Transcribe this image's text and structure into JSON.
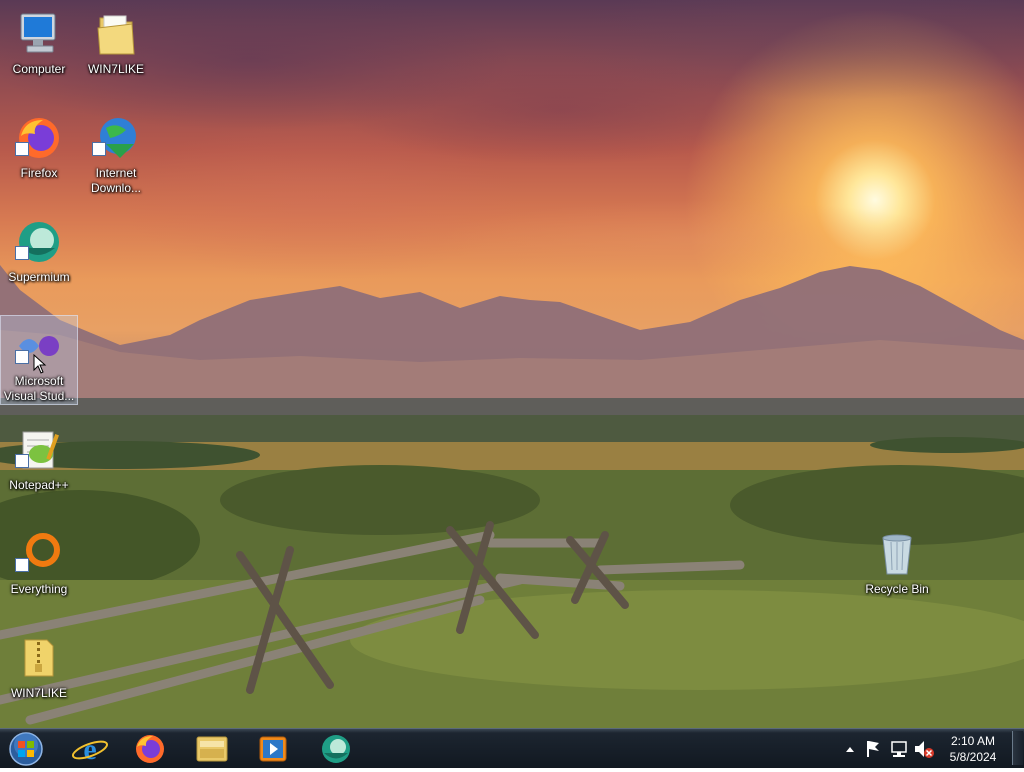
{
  "desktop_icons": [
    {
      "label": "Computer",
      "icon": "computer-icon"
    },
    {
      "label": "WIN7LIKE",
      "icon": "folder-icon"
    },
    {
      "label": "Firefox",
      "icon": "firefox-icon"
    },
    {
      "label": "Internet Downlo...",
      "icon": "internet-download-manager-icon"
    },
    {
      "label": "Supermium",
      "icon": "supermium-icon"
    },
    {
      "label": "Microsoft Visual Stud...",
      "icon": "visual-studio-icon"
    },
    {
      "label": "Notepad++",
      "icon": "notepad-plus-plus-icon"
    },
    {
      "label": "Everything",
      "icon": "everything-icon"
    },
    {
      "label": "WIN7LIKE",
      "icon": "zip-folder-icon"
    },
    {
      "label": "Recycle Bin",
      "icon": "recycle-bin-icon"
    }
  ],
  "taskbar": {
    "start_icon": "windows-start-orb-icon",
    "pinned": [
      {
        "name": "internet-explorer",
        "icon": "internet-explorer-icon"
      },
      {
        "name": "firefox",
        "icon": "firefox-icon"
      },
      {
        "name": "file-explorer",
        "icon": "file-explorer-icon"
      },
      {
        "name": "media-player",
        "icon": "media-player-icon"
      },
      {
        "name": "supermium",
        "icon": "supermium-icon"
      }
    ],
    "tray_icons": [
      "show-hidden-icons-arrow-icon",
      "action-center-flag-icon",
      "network-icon",
      "volume-muted-icon"
    ],
    "clock": {
      "time": "2:10 AM",
      "date": "5/8/2024"
    }
  },
  "colors": {
    "taskbar": "#111820",
    "selection": "#bec8eb"
  }
}
